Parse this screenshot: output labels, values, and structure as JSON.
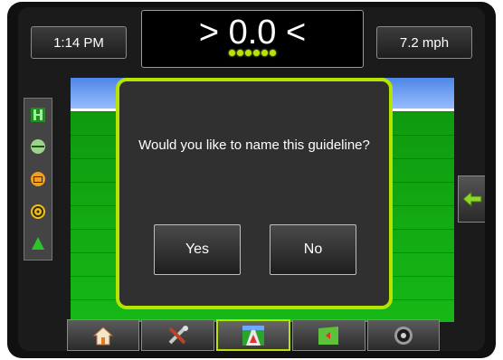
{
  "status": {
    "time": "1:14 PM",
    "speed": "7.2 mph",
    "xtrack_value": "> 0.0 <",
    "xtrack_leds": 6
  },
  "dialog": {
    "question": "Would you like to name this guideline?",
    "yes_label": "Yes",
    "no_label": "No"
  },
  "left_toolbar": {
    "icons": [
      "guidance-mode-icon",
      "line-icon",
      "camera-icon",
      "steering-icon",
      "pointer-icon"
    ]
  },
  "right_button": {
    "icon": "arrow-left-icon"
  },
  "bottom_nav": {
    "items": [
      "home-icon",
      "tools-icon",
      "guidance-view-icon",
      "map-icon",
      "gauge-icon"
    ],
    "active": "guidance-view-icon"
  },
  "colors": {
    "accent": "#b6e400",
    "field": "#16b816",
    "sky": "#7aa8ff"
  }
}
